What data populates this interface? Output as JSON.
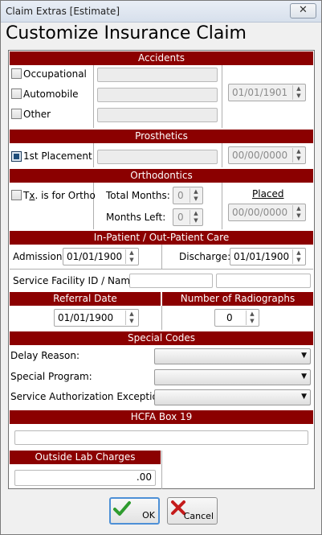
{
  "window": {
    "title": "Claim Extras [Estimate]",
    "close_glyph": "✕"
  },
  "heading": "Customize Insurance Claim",
  "accidents": {
    "header": "Accidents",
    "occupational": {
      "label": "Occupational",
      "checked": false
    },
    "automobile": {
      "label": "Automobile",
      "checked": false
    },
    "other": {
      "label": "Other",
      "checked": false
    },
    "date": "01/01/1901"
  },
  "prosthetics": {
    "header": "Prosthetics",
    "first_placement": {
      "label": "1st Placement",
      "checked": true
    },
    "date": "00/00/0000"
  },
  "orthodontics": {
    "header": "Orthodontics",
    "tx_for_ortho": {
      "label_prefix": "T",
      "label_underlined": "x",
      "label_suffix": ". is for Ortho",
      "checked": false
    },
    "total_months_label": "Total Months:",
    "total_months": "0",
    "months_left_label": "Months Left:",
    "months_left": "0",
    "placed_label": "Placed",
    "placed_date": "00/00/0000"
  },
  "care": {
    "header": "In-Patient / Out-Patient Care",
    "admission_label": "Admission:",
    "admission": "01/01/1900",
    "discharge_label": "Discharge:",
    "discharge": "01/01/1900",
    "facility_label": "Service Facility ID / Name:",
    "facility_id": "",
    "facility_name": ""
  },
  "referral": {
    "header": "Referral Date",
    "date": "01/01/1900"
  },
  "radiographs": {
    "header": "Number of Radiographs",
    "count": "0"
  },
  "special_codes": {
    "header": "Special Codes",
    "delay_reason_label": "Delay Reason:",
    "delay_reason": "",
    "special_program_label": "Special Program:",
    "special_program": "",
    "auth_exception_label": "Service Authorization Exception:",
    "auth_exception": ""
  },
  "hcfa": {
    "header": "HCFA Box 19",
    "value": ""
  },
  "lab": {
    "header": "Outside Lab Charges",
    "value": ".00"
  },
  "buttons": {
    "ok": "OK",
    "cancel": "Cancel"
  },
  "colors": {
    "section_header": "#8b0000",
    "ok_icon": "#2e9b2e",
    "cancel_icon": "#c41b1b"
  }
}
